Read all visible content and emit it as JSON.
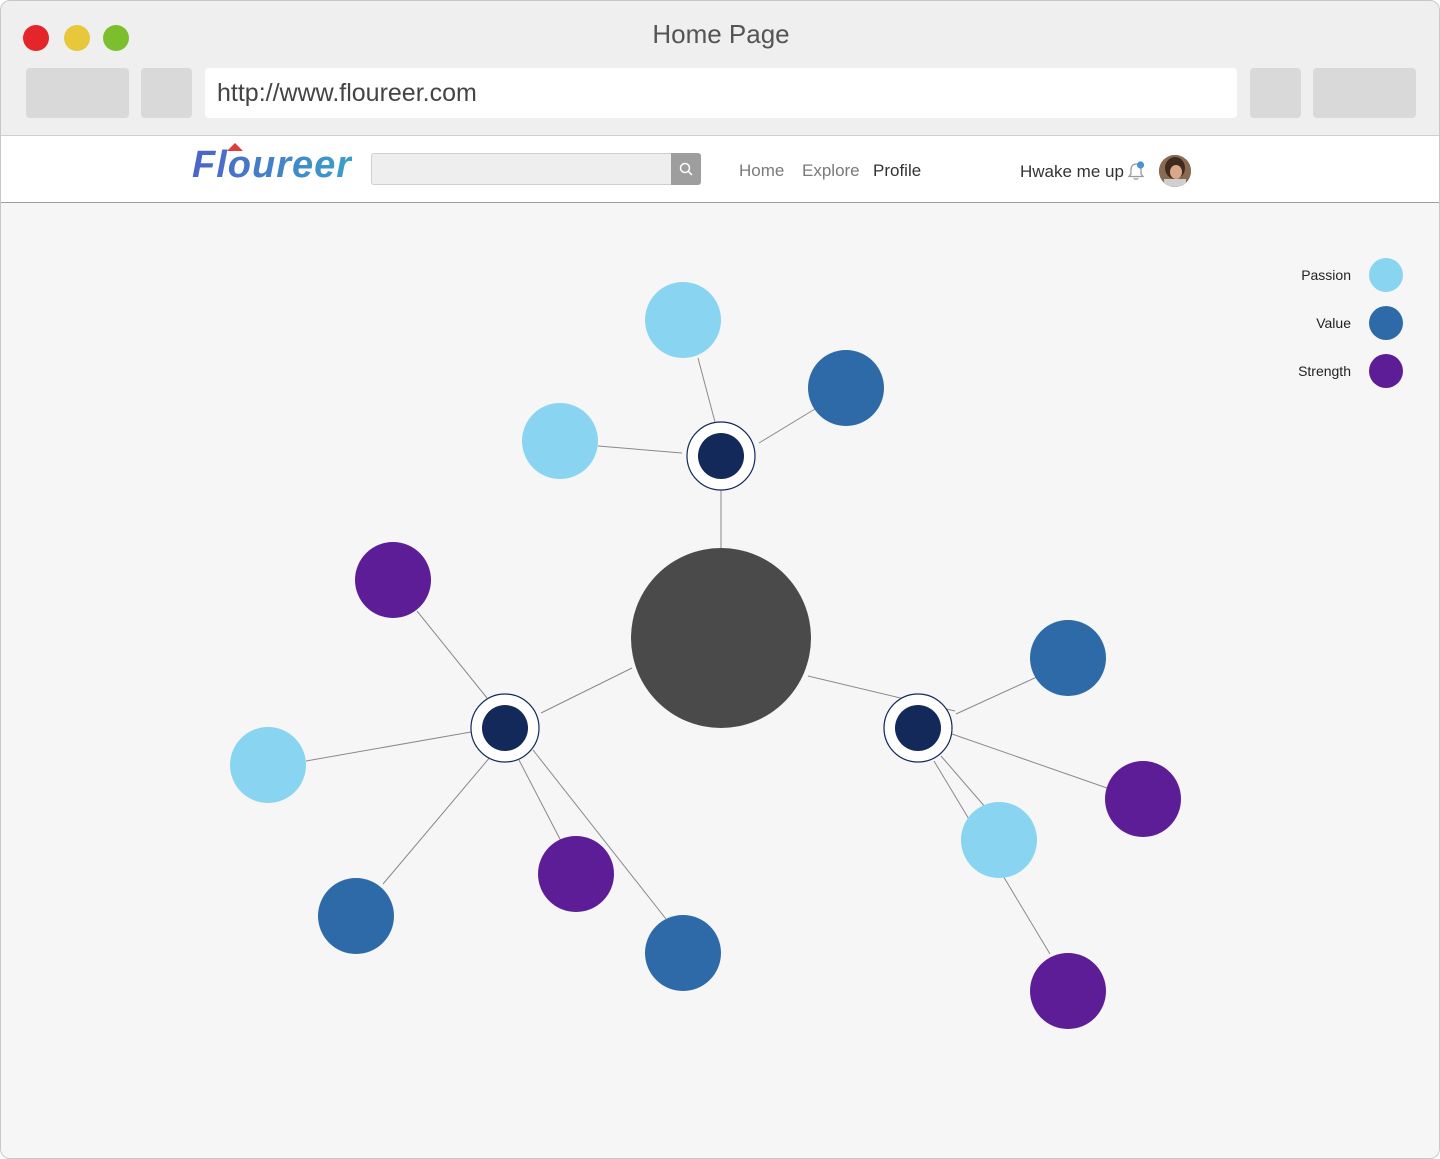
{
  "window": {
    "title": "Home Page",
    "url": "http://www.floureer.com",
    "traffic_lights": [
      "close",
      "minimize",
      "zoom"
    ]
  },
  "navbar": {
    "logo": "Floureer",
    "search": {
      "value": "",
      "placeholder": ""
    },
    "links": [
      {
        "label": "Home",
        "active": false
      },
      {
        "label": "Explore",
        "active": false
      },
      {
        "label": "Profile",
        "active": true
      }
    ],
    "wake_label": "Hwake me up",
    "icons": [
      "search-icon",
      "bell-icon",
      "avatar"
    ]
  },
  "legend": {
    "items": [
      {
        "label": "Passion",
        "color": "#89d5f1"
      },
      {
        "label": "Value",
        "color": "#2e6aa8"
      },
      {
        "label": "Strength",
        "color": "#5c1d97"
      }
    ]
  },
  "graph": {
    "colors": {
      "center": "#4a4a4a",
      "hub": "#13295a",
      "passion": "#89d5f1",
      "value": "#2e6aa8",
      "strength": "#5c1d97",
      "edge": "#8a8a8a"
    },
    "hubs": [
      {
        "id": "hub-top",
        "children": [
          "passion",
          "value",
          "passion"
        ]
      },
      {
        "id": "hub-left",
        "children": [
          "strength",
          "passion",
          "value",
          "strength",
          "value"
        ]
      },
      {
        "id": "hub-right",
        "children": [
          "value",
          "strength",
          "passion",
          "strength"
        ]
      }
    ]
  }
}
